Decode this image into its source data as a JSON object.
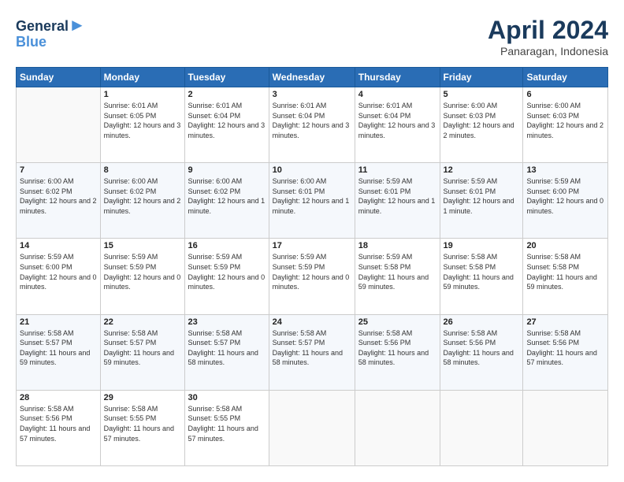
{
  "logo": {
    "line1": "General",
    "line2": "Blue"
  },
  "header": {
    "title": "April 2024",
    "subtitle": "Panaragan, Indonesia"
  },
  "weekdays": [
    "Sunday",
    "Monday",
    "Tuesday",
    "Wednesday",
    "Thursday",
    "Friday",
    "Saturday"
  ],
  "weeks": [
    [
      {
        "day": "",
        "sunrise": "",
        "sunset": "",
        "daylight": ""
      },
      {
        "day": "1",
        "sunrise": "Sunrise: 6:01 AM",
        "sunset": "Sunset: 6:05 PM",
        "daylight": "Daylight: 12 hours and 3 minutes."
      },
      {
        "day": "2",
        "sunrise": "Sunrise: 6:01 AM",
        "sunset": "Sunset: 6:04 PM",
        "daylight": "Daylight: 12 hours and 3 minutes."
      },
      {
        "day": "3",
        "sunrise": "Sunrise: 6:01 AM",
        "sunset": "Sunset: 6:04 PM",
        "daylight": "Daylight: 12 hours and 3 minutes."
      },
      {
        "day": "4",
        "sunrise": "Sunrise: 6:01 AM",
        "sunset": "Sunset: 6:04 PM",
        "daylight": "Daylight: 12 hours and 3 minutes."
      },
      {
        "day": "5",
        "sunrise": "Sunrise: 6:00 AM",
        "sunset": "Sunset: 6:03 PM",
        "daylight": "Daylight: 12 hours and 2 minutes."
      },
      {
        "day": "6",
        "sunrise": "Sunrise: 6:00 AM",
        "sunset": "Sunset: 6:03 PM",
        "daylight": "Daylight: 12 hours and 2 minutes."
      }
    ],
    [
      {
        "day": "7",
        "sunrise": "Sunrise: 6:00 AM",
        "sunset": "Sunset: 6:02 PM",
        "daylight": "Daylight: 12 hours and 2 minutes."
      },
      {
        "day": "8",
        "sunrise": "Sunrise: 6:00 AM",
        "sunset": "Sunset: 6:02 PM",
        "daylight": "Daylight: 12 hours and 2 minutes."
      },
      {
        "day": "9",
        "sunrise": "Sunrise: 6:00 AM",
        "sunset": "Sunset: 6:02 PM",
        "daylight": "Daylight: 12 hours and 1 minute."
      },
      {
        "day": "10",
        "sunrise": "Sunrise: 6:00 AM",
        "sunset": "Sunset: 6:01 PM",
        "daylight": "Daylight: 12 hours and 1 minute."
      },
      {
        "day": "11",
        "sunrise": "Sunrise: 5:59 AM",
        "sunset": "Sunset: 6:01 PM",
        "daylight": "Daylight: 12 hours and 1 minute."
      },
      {
        "day": "12",
        "sunrise": "Sunrise: 5:59 AM",
        "sunset": "Sunset: 6:01 PM",
        "daylight": "Daylight: 12 hours and 1 minute."
      },
      {
        "day": "13",
        "sunrise": "Sunrise: 5:59 AM",
        "sunset": "Sunset: 6:00 PM",
        "daylight": "Daylight: 12 hours and 0 minutes."
      }
    ],
    [
      {
        "day": "14",
        "sunrise": "Sunrise: 5:59 AM",
        "sunset": "Sunset: 6:00 PM",
        "daylight": "Daylight: 12 hours and 0 minutes."
      },
      {
        "day": "15",
        "sunrise": "Sunrise: 5:59 AM",
        "sunset": "Sunset: 5:59 PM",
        "daylight": "Daylight: 12 hours and 0 minutes."
      },
      {
        "day": "16",
        "sunrise": "Sunrise: 5:59 AM",
        "sunset": "Sunset: 5:59 PM",
        "daylight": "Daylight: 12 hours and 0 minutes."
      },
      {
        "day": "17",
        "sunrise": "Sunrise: 5:59 AM",
        "sunset": "Sunset: 5:59 PM",
        "daylight": "Daylight: 12 hours and 0 minutes."
      },
      {
        "day": "18",
        "sunrise": "Sunrise: 5:59 AM",
        "sunset": "Sunset: 5:58 PM",
        "daylight": "Daylight: 11 hours and 59 minutes."
      },
      {
        "day": "19",
        "sunrise": "Sunrise: 5:58 AM",
        "sunset": "Sunset: 5:58 PM",
        "daylight": "Daylight: 11 hours and 59 minutes."
      },
      {
        "day": "20",
        "sunrise": "Sunrise: 5:58 AM",
        "sunset": "Sunset: 5:58 PM",
        "daylight": "Daylight: 11 hours and 59 minutes."
      }
    ],
    [
      {
        "day": "21",
        "sunrise": "Sunrise: 5:58 AM",
        "sunset": "Sunset: 5:57 PM",
        "daylight": "Daylight: 11 hours and 59 minutes."
      },
      {
        "day": "22",
        "sunrise": "Sunrise: 5:58 AM",
        "sunset": "Sunset: 5:57 PM",
        "daylight": "Daylight: 11 hours and 59 minutes."
      },
      {
        "day": "23",
        "sunrise": "Sunrise: 5:58 AM",
        "sunset": "Sunset: 5:57 PM",
        "daylight": "Daylight: 11 hours and 58 minutes."
      },
      {
        "day": "24",
        "sunrise": "Sunrise: 5:58 AM",
        "sunset": "Sunset: 5:57 PM",
        "daylight": "Daylight: 11 hours and 58 minutes."
      },
      {
        "day": "25",
        "sunrise": "Sunrise: 5:58 AM",
        "sunset": "Sunset: 5:56 PM",
        "daylight": "Daylight: 11 hours and 58 minutes."
      },
      {
        "day": "26",
        "sunrise": "Sunrise: 5:58 AM",
        "sunset": "Sunset: 5:56 PM",
        "daylight": "Daylight: 11 hours and 58 minutes."
      },
      {
        "day": "27",
        "sunrise": "Sunrise: 5:58 AM",
        "sunset": "Sunset: 5:56 PM",
        "daylight": "Daylight: 11 hours and 57 minutes."
      }
    ],
    [
      {
        "day": "28",
        "sunrise": "Sunrise: 5:58 AM",
        "sunset": "Sunset: 5:56 PM",
        "daylight": "Daylight: 11 hours and 57 minutes."
      },
      {
        "day": "29",
        "sunrise": "Sunrise: 5:58 AM",
        "sunset": "Sunset: 5:55 PM",
        "daylight": "Daylight: 11 hours and 57 minutes."
      },
      {
        "day": "30",
        "sunrise": "Sunrise: 5:58 AM",
        "sunset": "Sunset: 5:55 PM",
        "daylight": "Daylight: 11 hours and 57 minutes."
      },
      {
        "day": "",
        "sunrise": "",
        "sunset": "",
        "daylight": ""
      },
      {
        "day": "",
        "sunrise": "",
        "sunset": "",
        "daylight": ""
      },
      {
        "day": "",
        "sunrise": "",
        "sunset": "",
        "daylight": ""
      },
      {
        "day": "",
        "sunrise": "",
        "sunset": "",
        "daylight": ""
      }
    ]
  ]
}
